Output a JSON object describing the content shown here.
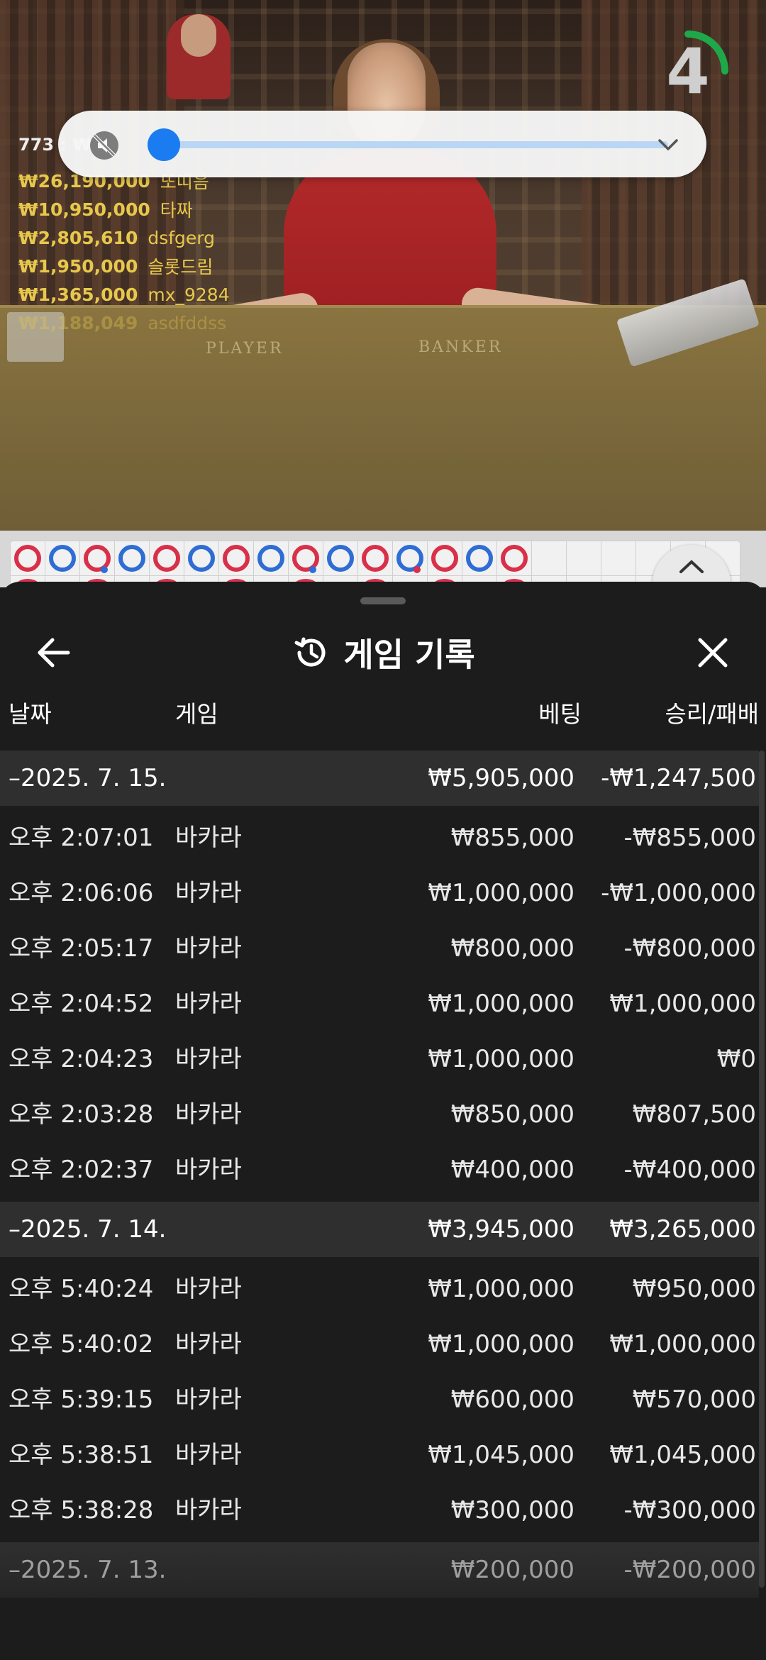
{
  "video": {
    "table_labels": {
      "player": "PLAYER",
      "banker": "BANKER"
    },
    "countdown": {
      "value": "4",
      "progress": 0.25,
      "ring_color": "#1fa84a"
    },
    "winners": {
      "first_partial": "773 : ₩ 0",
      "rows": [
        {
          "amount": "₩26,190,000",
          "name": "또띠음"
        },
        {
          "amount": "₩10,950,000",
          "name": "타짜"
        },
        {
          "amount": "₩2,805,610",
          "name": "dsfgerg"
        },
        {
          "amount": "₩1,950,000",
          "name": "슬롯드림"
        },
        {
          "amount": "₩1,365,000",
          "name": "mx_9284"
        },
        {
          "amount": "₩1,188,049",
          "name": "asdfddss"
        }
      ]
    }
  },
  "volume_popup": {
    "level": 0.0,
    "muted": true,
    "icons": {
      "mute": "volume-muted-icon",
      "collapse": "chevron-down-icon"
    },
    "colors": {
      "track": "#b9d6f5",
      "thumb": "#1a7cf0"
    }
  },
  "roadmap": {
    "beads": [
      "red",
      "blue",
      "red-blue",
      "blue",
      "red",
      "blue",
      "red",
      "blue",
      "red-blue",
      "blue",
      "red",
      "blue-red",
      "red",
      "blue",
      "red"
    ],
    "colors": {
      "player": "#2f6dd4",
      "banker": "#d9304a"
    },
    "toggle_icon": "chevron-up-icon"
  },
  "sheet": {
    "title": "게임 기록",
    "icons": {
      "back": "arrow-left-icon",
      "history": "history-icon",
      "close": "close-icon"
    },
    "columns": {
      "date": "날짜",
      "game": "게임",
      "bet": "베팅",
      "win_loss": "승리/패배"
    },
    "groups": [
      {
        "date": "–2025. 7. 15.",
        "bet": "₩5,905,000",
        "win": "-₩1,247,500",
        "rows": [
          {
            "time": "오후 2:07:01",
            "game": "바카라",
            "bet": "₩855,000",
            "win": "-₩855,000"
          },
          {
            "time": "오후 2:06:06",
            "game": "바카라",
            "bet": "₩1,000,000",
            "win": "-₩1,000,000"
          },
          {
            "time": "오후 2:05:17",
            "game": "바카라",
            "bet": "₩800,000",
            "win": "-₩800,000"
          },
          {
            "time": "오후 2:04:52",
            "game": "바카라",
            "bet": "₩1,000,000",
            "win": "₩1,000,000"
          },
          {
            "time": "오후 2:04:23",
            "game": "바카라",
            "bet": "₩1,000,000",
            "win": "₩0"
          },
          {
            "time": "오후 2:03:28",
            "game": "바카라",
            "bet": "₩850,000",
            "win": "₩807,500"
          },
          {
            "time": "오후 2:02:37",
            "game": "바카라",
            "bet": "₩400,000",
            "win": "-₩400,000"
          }
        ]
      },
      {
        "date": "–2025. 7. 14.",
        "bet": "₩3,945,000",
        "win": "₩3,265,000",
        "rows": [
          {
            "time": "오후 5:40:24",
            "game": "바카라",
            "bet": "₩1,000,000",
            "win": "₩950,000"
          },
          {
            "time": "오후 5:40:02",
            "game": "바카라",
            "bet": "₩1,000,000",
            "win": "₩1,000,000"
          },
          {
            "time": "오후 5:39:15",
            "game": "바카라",
            "bet": "₩600,000",
            "win": "₩570,000"
          },
          {
            "time": "오후 5:38:51",
            "game": "바카라",
            "bet": "₩1,045,000",
            "win": "₩1,045,000"
          },
          {
            "time": "오후 5:38:28",
            "game": "바카라",
            "bet": "₩300,000",
            "win": "-₩300,000"
          }
        ]
      },
      {
        "date": "–2025. 7. 13.",
        "bet": "₩200,000",
        "win": "-₩200,000",
        "rows": []
      }
    ]
  }
}
